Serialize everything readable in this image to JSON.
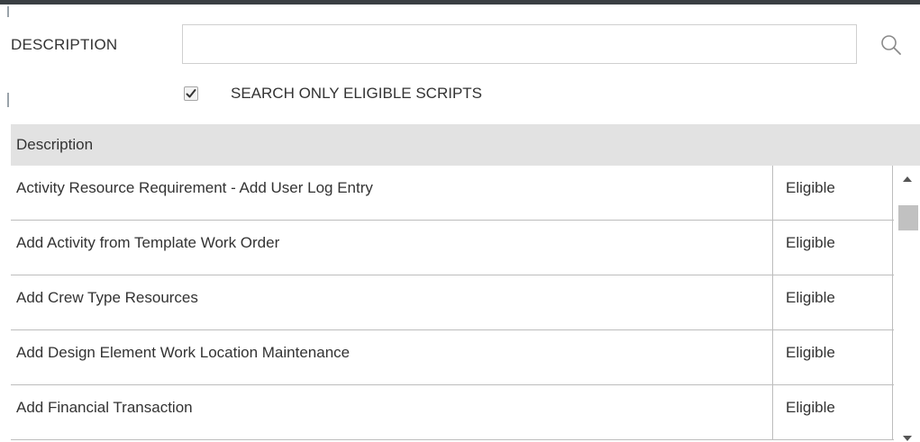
{
  "search": {
    "description_label": "DESCRIPTION",
    "description_value": "",
    "description_placeholder": "",
    "search_icon": "search-icon",
    "eligible_only_label": "SEARCH ONLY ELIGIBLE SCRIPTS",
    "eligible_only_checked": true
  },
  "grid": {
    "header_description": "Description",
    "rows": [
      {
        "description": "Activity Resource Requirement - Add User Log Entry",
        "status": "Eligible"
      },
      {
        "description": "Add Activity from Template Work Order",
        "status": "Eligible"
      },
      {
        "description": "Add Crew Type Resources",
        "status": "Eligible"
      },
      {
        "description": "Add Design Element Work Location Maintenance",
        "status": "Eligible"
      },
      {
        "description": "Add Financial Transaction",
        "status": "Eligible"
      }
    ]
  },
  "colors": {
    "header_bg": "#e2e2e2",
    "row_border": "#bdbdbd",
    "top_border": "#3a3f43"
  }
}
